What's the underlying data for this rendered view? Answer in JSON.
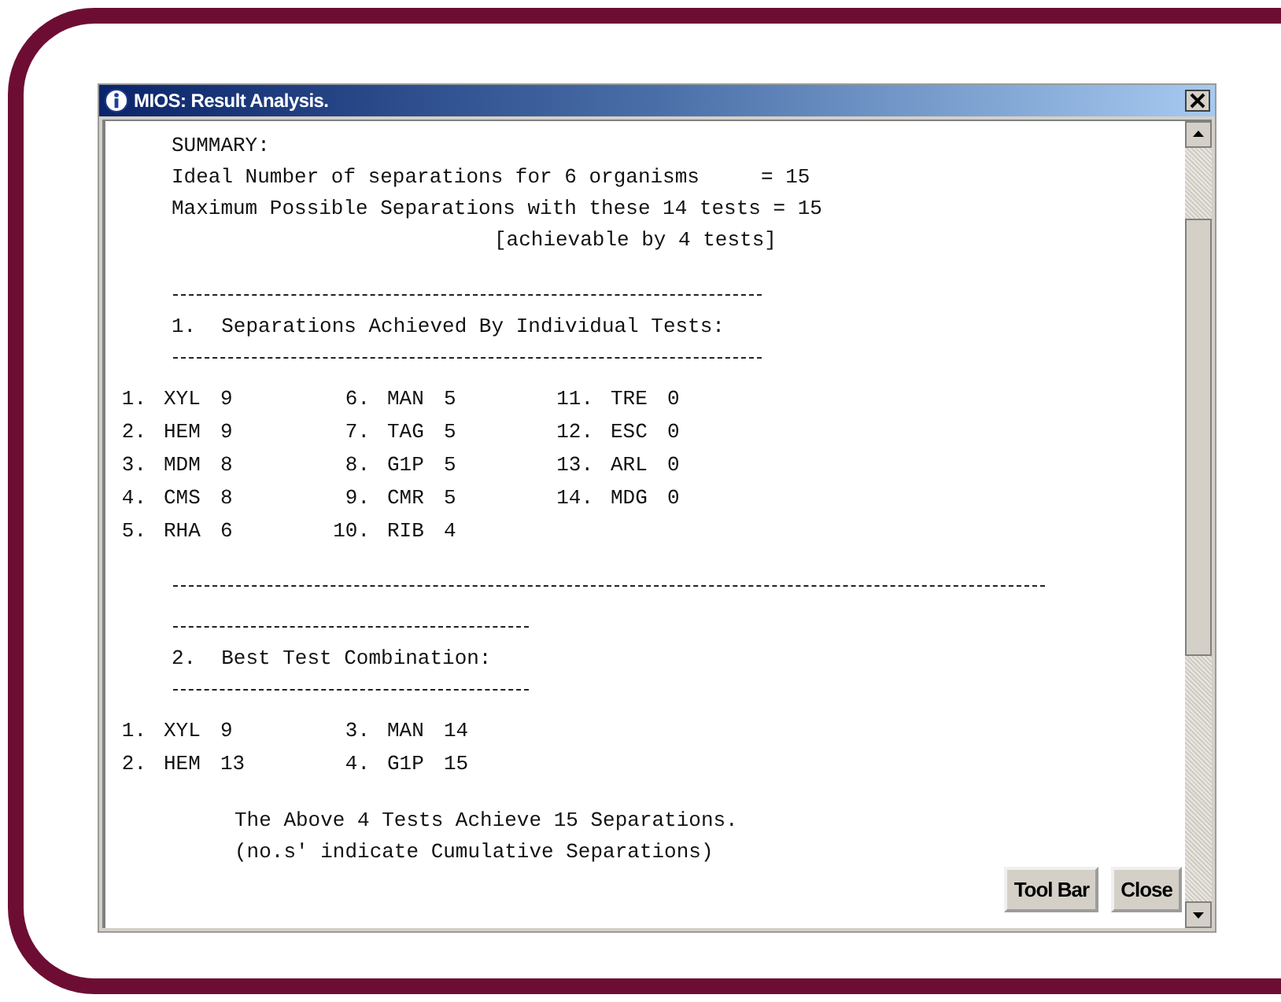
{
  "window": {
    "title": "MIOS: Result Analysis."
  },
  "summary": {
    "heading": "SUMMARY:",
    "lines": [
      {
        "kind": "line",
        "text": "Ideal Number of separations for 6 organisms     = 15"
      },
      {
        "kind": "line",
        "text": "Maximum Possible Separations with these 14 tests = 15"
      },
      {
        "kind": "note",
        "text": "[achievable by 4 tests]"
      }
    ]
  },
  "sections": [
    {
      "number": "1.",
      "title": "Separations Achieved By Individual Tests:",
      "items": [
        {
          "num": "1.",
          "code": "XYL",
          "value": "9"
        },
        {
          "num": "2.",
          "code": "HEM",
          "value": "9"
        },
        {
          "num": "3.",
          "code": "MDM",
          "value": "8"
        },
        {
          "num": "4.",
          "code": "CMS",
          "value": "8"
        },
        {
          "num": "5.",
          "code": "RHA",
          "value": "6"
        },
        {
          "num": "6.",
          "code": "MAN",
          "value": "5"
        },
        {
          "num": "7.",
          "code": "TAG",
          "value": "5"
        },
        {
          "num": "8.",
          "code": "G1P",
          "value": "5"
        },
        {
          "num": "9.",
          "code": "CMR",
          "value": "5"
        },
        {
          "num": "10.",
          "code": "RIB",
          "value": "4"
        },
        {
          "num": "11.",
          "code": "TRE",
          "value": "0"
        },
        {
          "num": "12.",
          "code": "ESC",
          "value": "0"
        },
        {
          "num": "13.",
          "code": "ARL",
          "value": "0"
        },
        {
          "num": "14.",
          "code": "MDG",
          "value": "0"
        }
      ]
    },
    {
      "number": "2.",
      "title": "Best Test Combination:",
      "items": [
        {
          "num": "1.",
          "code": "XYL",
          "value": "9"
        },
        {
          "num": "2.",
          "code": "HEM",
          "value": "13"
        },
        {
          "num": "3.",
          "code": "MAN",
          "value": "14"
        },
        {
          "num": "4.",
          "code": "G1P",
          "value": "15"
        }
      ]
    }
  ],
  "footer": [
    "The Above 4 Tests Achieve 15 Separations.",
    "(no.s' indicate Cumulative Separations)"
  ],
  "buttons": [
    "Tool Bar",
    "Close"
  ]
}
